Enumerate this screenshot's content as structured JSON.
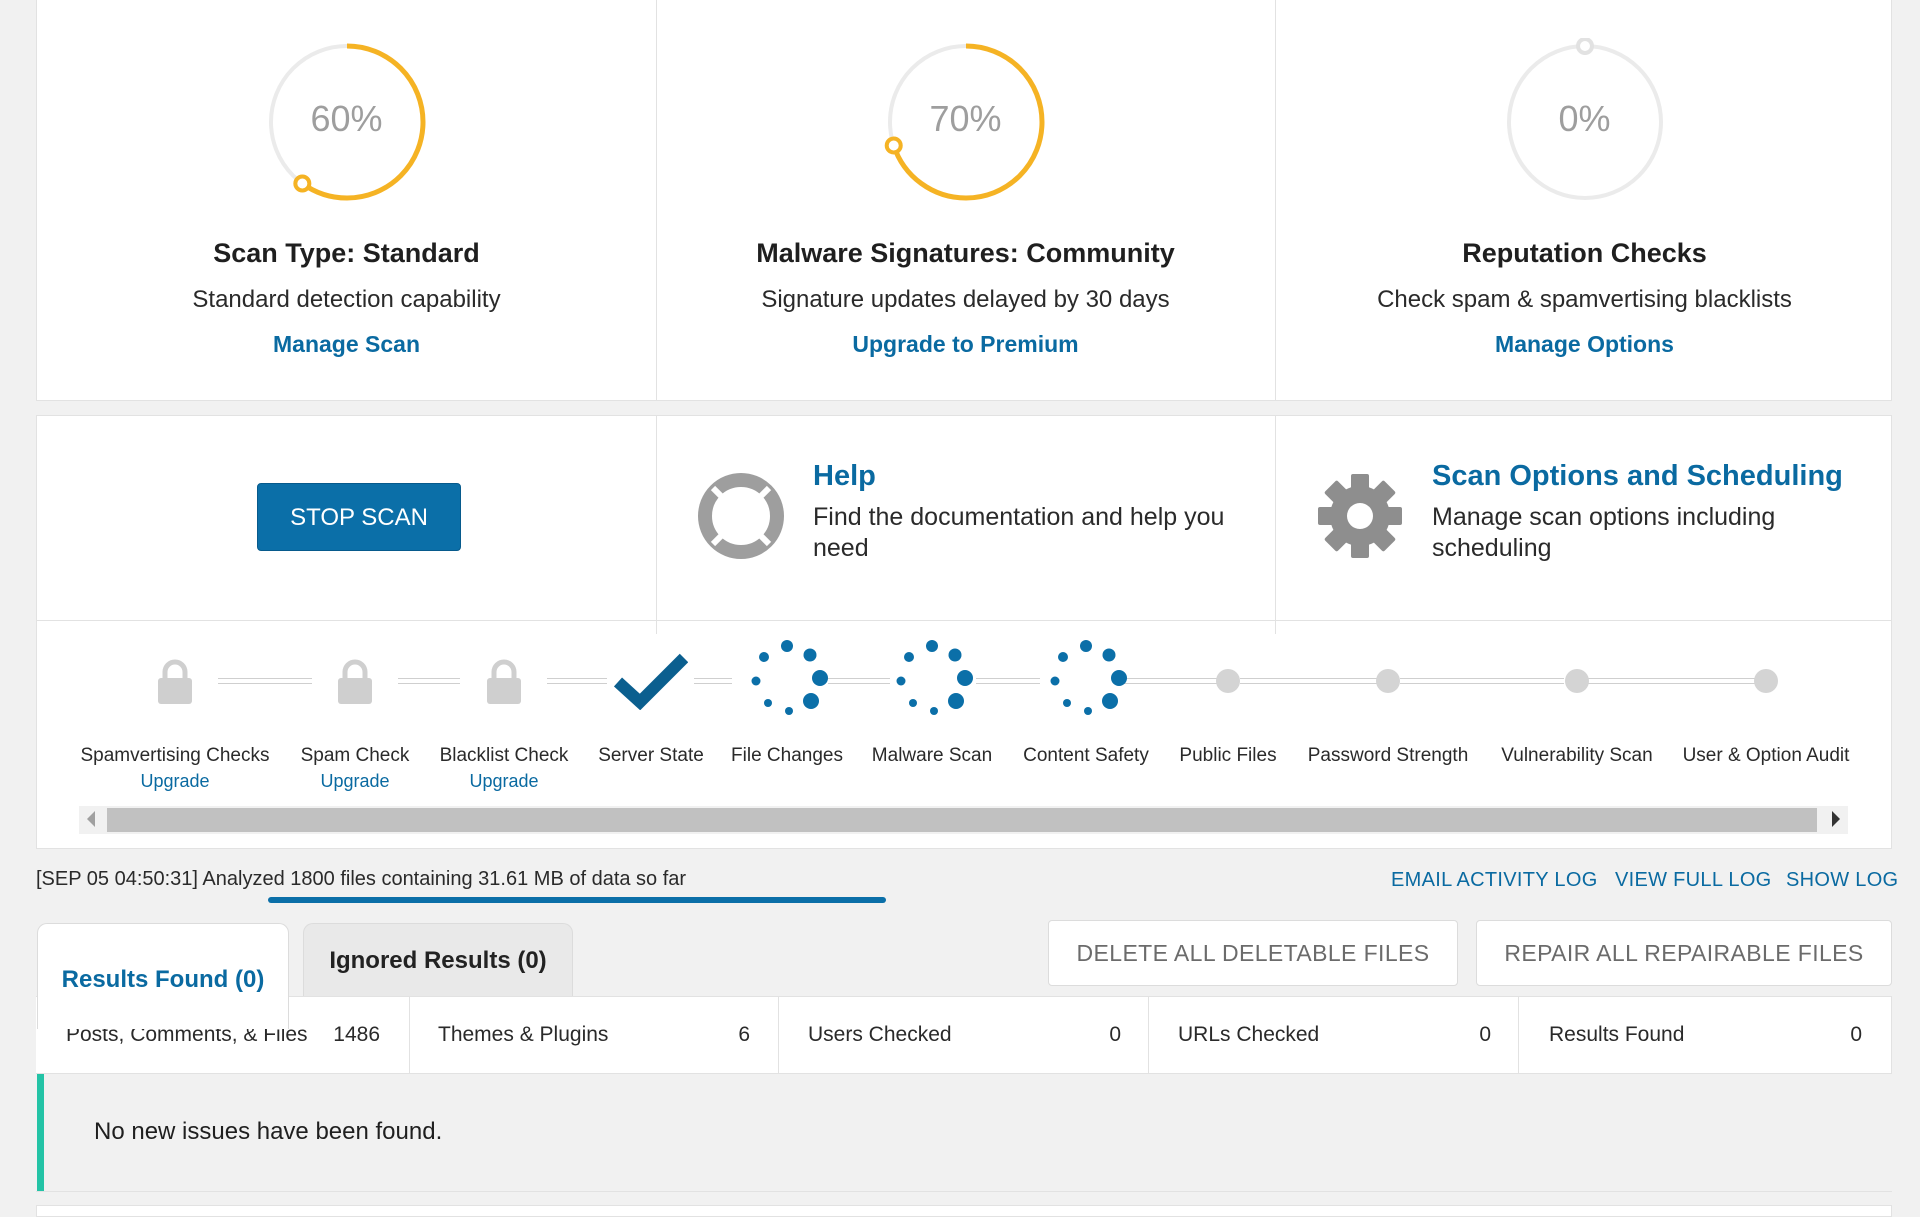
{
  "cards": [
    {
      "pct": "60%",
      "title": "Scan Type: Standard",
      "desc": "Standard detection capability",
      "link": "Manage Scan",
      "progress": 0.6
    },
    {
      "pct": "70%",
      "title": "Malware Signatures: Community",
      "desc": "Signature updates delayed by 30 days",
      "link": "Upgrade to Premium",
      "progress": 0.7
    },
    {
      "pct": "0%",
      "title": "Reputation Checks",
      "desc": "Check spam & spamvertising blacklists",
      "link": "Manage Options",
      "progress": 0
    }
  ],
  "actions": {
    "stop_label": "STOP SCAN",
    "help_title": "Help",
    "help_desc_1": "Find the documentation and help you",
    "help_desc_2": "need",
    "options_title": "Scan Options and Scheduling",
    "options_desc_1": "Manage scan options including",
    "options_desc_2": "scheduling"
  },
  "stages": [
    {
      "label": "Spamvertising Checks",
      "status": "locked",
      "upgrade": "Upgrade"
    },
    {
      "label": "Spam Check",
      "status": "locked",
      "upgrade": "Upgrade"
    },
    {
      "label": "Blacklist Check",
      "status": "locked",
      "upgrade": "Upgrade"
    },
    {
      "label": "Server State",
      "status": "complete"
    },
    {
      "label": "File Changes",
      "status": "running"
    },
    {
      "label": "Malware Scan",
      "status": "running"
    },
    {
      "label": "Content Safety",
      "status": "running"
    },
    {
      "label": "Public Files",
      "status": "pending"
    },
    {
      "label": "Password Strength",
      "status": "pending"
    },
    {
      "label": "Vulnerability Scan",
      "status": "pending"
    },
    {
      "label": "User & Option Audit",
      "status": "pending"
    }
  ],
  "status_line": "[SEP 05 04:50:31] Analyzed 1800 files containing 31.61 MB of data so far",
  "logs": {
    "email": "EMAIL ACTIVITY LOG",
    "full": "VIEW FULL LOG",
    "show": "SHOW LOG"
  },
  "tabs": {
    "results": "Results Found (0)",
    "ignored": "Ignored Results (0)"
  },
  "bulk": {
    "delete": "DELETE ALL DELETABLE FILES",
    "repair": "REPAIR ALL REPAIRABLE FILES"
  },
  "stats": [
    {
      "label": "Posts, Comments, & Files",
      "value": "1486"
    },
    {
      "label": "Themes & Plugins",
      "value": "6"
    },
    {
      "label": "Users Checked",
      "value": "0"
    },
    {
      "label": "URLs Checked",
      "value": "0"
    },
    {
      "label": "Results Found",
      "value": "0"
    }
  ],
  "notice": "No new issues have been found.",
  "colors": {
    "accent": "#0b6fa8",
    "progress": "#f5b324",
    "success": "#23c3a6",
    "link": "#0a6aa1"
  }
}
